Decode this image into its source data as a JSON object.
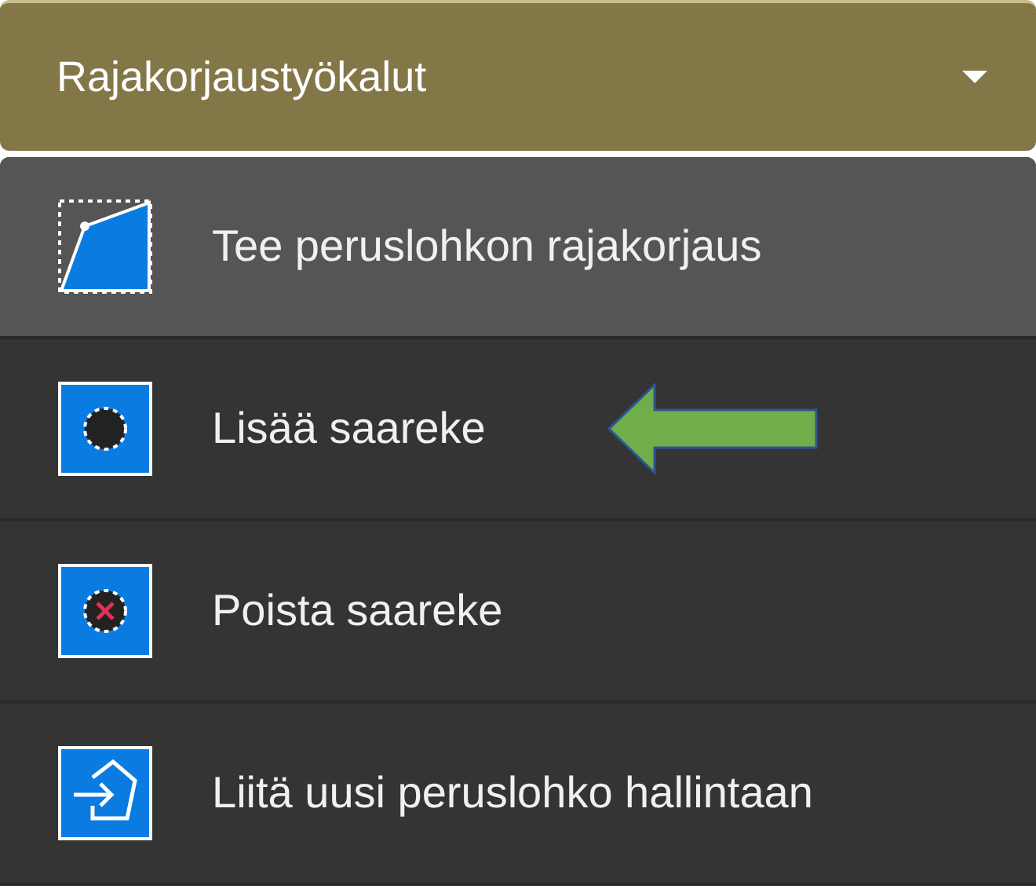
{
  "dropdown": {
    "label": "Rajakorjaustyökalut",
    "expanded": true
  },
  "menu": [
    {
      "label": "Tee peruslohkon rajakorjaus",
      "kind": "boundary",
      "selected": true,
      "arrow": false
    },
    {
      "label": "Lisää saareke",
      "kind": "add-island",
      "selected": false,
      "arrow": true
    },
    {
      "label": "Poista saareke",
      "kind": "remove-island",
      "selected": false,
      "arrow": false
    },
    {
      "label": "Liitä uusi peruslohko hallintaan",
      "kind": "attach",
      "selected": false,
      "arrow": false
    }
  ]
}
